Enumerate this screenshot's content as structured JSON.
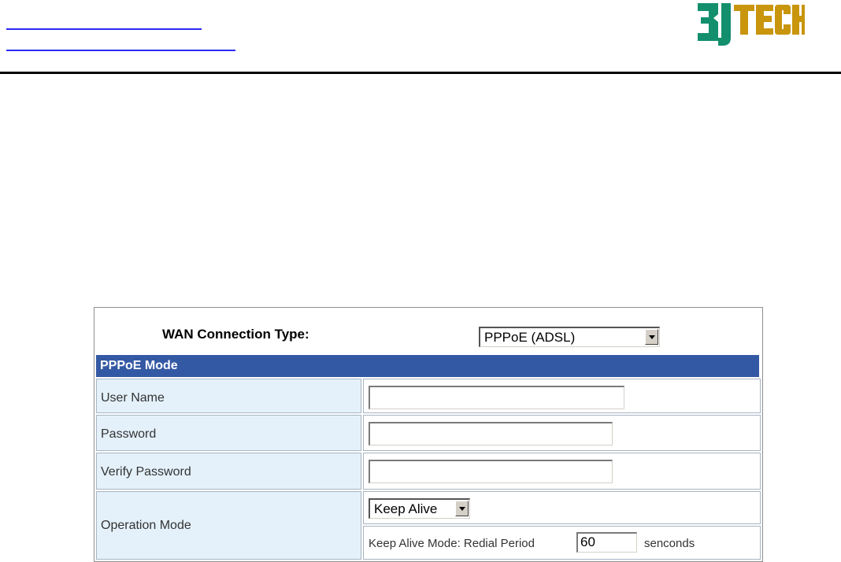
{
  "brand": {
    "logo_text_a": "3J",
    "logo_text_b": "TECH"
  },
  "wan": {
    "label": "WAN Connection Type:",
    "selected": "PPPoE (ADSL)"
  },
  "section": {
    "title": "PPPoE Mode"
  },
  "fields": {
    "user_name": {
      "label": "User Name",
      "value": ""
    },
    "password": {
      "label": "Password",
      "value": ""
    },
    "verify_password": {
      "label": "Verify Password",
      "value": ""
    },
    "operation_mode": {
      "label": "Operation Mode",
      "selected": "Keep Alive",
      "redial_label": "Keep Alive Mode: Redial Period",
      "redial_value": "60",
      "unit": "senconds"
    }
  },
  "colors": {
    "section_bar": "#3459a4",
    "label_bg": "#e4f1fb",
    "logo_green": "#138f6e",
    "logo_gold": "#c8950c"
  }
}
